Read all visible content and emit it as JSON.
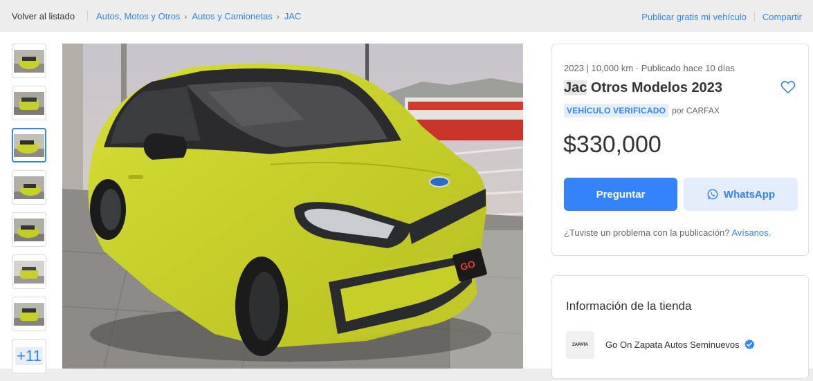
{
  "topbar": {
    "back": "Volver al listado",
    "breadcrumbs": [
      "Autos, Motos y Otros",
      "Autos y Camionetas",
      "JAC"
    ],
    "publish": "Publicar gratis mi vehículo",
    "share": "Compartir"
  },
  "gallery": {
    "more_count": "+11",
    "selected_index": 3
  },
  "listing": {
    "meta": "2023 | 10,000 km · Publicado hace 10 días",
    "title_highlight": "Jac",
    "title_rest": " Otros Modelos 2023",
    "verified_badge": "VEHÍCULO VERIFICADO",
    "verified_by": "por CARFAX",
    "price": "$330,000",
    "ask_button": "Preguntar",
    "whatsapp_button": "WhatsApp",
    "report_text": "¿Tuviste un problema con la publicación?",
    "report_link": "Avísanos."
  },
  "store": {
    "heading": "Información de la tienda",
    "logo_text": "ZAPATA",
    "name": "Go On Zapata Autos Seminuevos"
  },
  "colors": {
    "accent": "#3483fa",
    "accent_light": "#e3edfb",
    "car_body": "#c8d22a"
  }
}
